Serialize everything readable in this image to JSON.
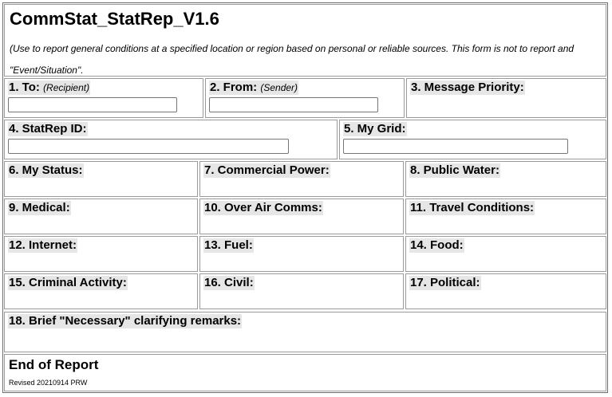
{
  "form": {
    "title": "CommStat_StatRep_V1.6",
    "intro": "(Use to report general conditions at a specified location or region based on personal or reliable sources. This form is not to report and \"Event/Situation\".",
    "to_label": "1. To:",
    "to_sub": "(Recipient)",
    "to_value": "",
    "from_label": "2. From:",
    "from_sub": "(Sender)",
    "from_value": "",
    "priority_label": "3. Message Priority:",
    "statrep_id_label": "4. StatRep ID:",
    "statrep_id_value": "",
    "grid_label": "5. My Grid:",
    "grid_value": "",
    "status_label": "6. My Status:",
    "power_label": "7. Commercial Power:",
    "water_label": "8. Public Water:",
    "medical_label": "9. Medical:",
    "comms_label": "10. Over Air Comms:",
    "travel_label": "11. Travel Conditions:",
    "internet_label": "12. Internet:",
    "fuel_label": "13. Fuel:",
    "food_label": "14. Food:",
    "crime_label": "15. Criminal Activity:",
    "civil_label": "16. Civil:",
    "political_label": "17. Political:",
    "remarks_label": "18. Brief \"Necessary\" clarifying remarks:",
    "end_label": "End of Report",
    "revised": "Revised 20210914 PRW"
  }
}
